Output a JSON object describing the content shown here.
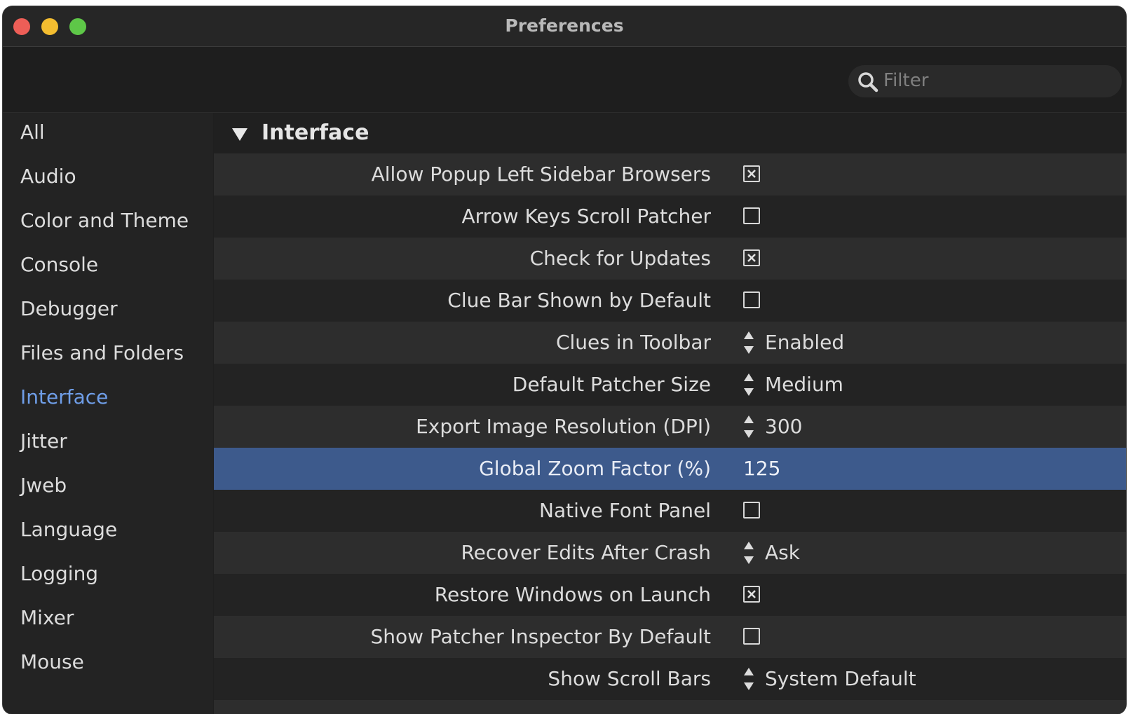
{
  "window": {
    "title": "Preferences"
  },
  "search": {
    "placeholder": "Filter",
    "value": ""
  },
  "sidebar": {
    "items": [
      {
        "label": "All"
      },
      {
        "label": "Audio"
      },
      {
        "label": "Color and Theme"
      },
      {
        "label": "Console"
      },
      {
        "label": "Debugger"
      },
      {
        "label": "Files and Folders"
      },
      {
        "label": "Interface",
        "active": true
      },
      {
        "label": "Jitter"
      },
      {
        "label": "Jweb"
      },
      {
        "label": "Language"
      },
      {
        "label": "Logging"
      },
      {
        "label": "Mixer"
      },
      {
        "label": "Mouse"
      }
    ]
  },
  "section": {
    "title": "Interface",
    "rows": [
      {
        "label": "Allow Popup Left Sidebar Browsers",
        "type": "checkbox",
        "checked": true
      },
      {
        "label": "Arrow Keys Scroll Patcher",
        "type": "checkbox",
        "checked": false
      },
      {
        "label": "Check for Updates",
        "type": "checkbox",
        "checked": true
      },
      {
        "label": "Clue Bar Shown by Default",
        "type": "checkbox",
        "checked": false
      },
      {
        "label": "Clues in Toolbar",
        "type": "menu",
        "value": "Enabled"
      },
      {
        "label": "Default Patcher Size",
        "type": "menu",
        "value": "Medium"
      },
      {
        "label": "Export Image Resolution (DPI)",
        "type": "menu",
        "value": "300"
      },
      {
        "label": "Global Zoom Factor (%)",
        "type": "number",
        "value": "125",
        "selected": true
      },
      {
        "label": "Native Font Panel",
        "type": "checkbox",
        "checked": false
      },
      {
        "label": "Recover Edits After Crash",
        "type": "menu",
        "value": "Ask"
      },
      {
        "label": "Restore Windows on Launch",
        "type": "checkbox",
        "checked": true
      },
      {
        "label": "Show Patcher Inspector By Default",
        "type": "checkbox",
        "checked": false
      },
      {
        "label": "Show Scroll Bars",
        "type": "menu",
        "value": "System Default"
      }
    ]
  },
  "colors": {
    "accent": "#6f9ee8",
    "selected_row": "#3d5a8c",
    "close": "#ed5e57",
    "minimize": "#f4bd30",
    "maximize": "#5ec748"
  }
}
